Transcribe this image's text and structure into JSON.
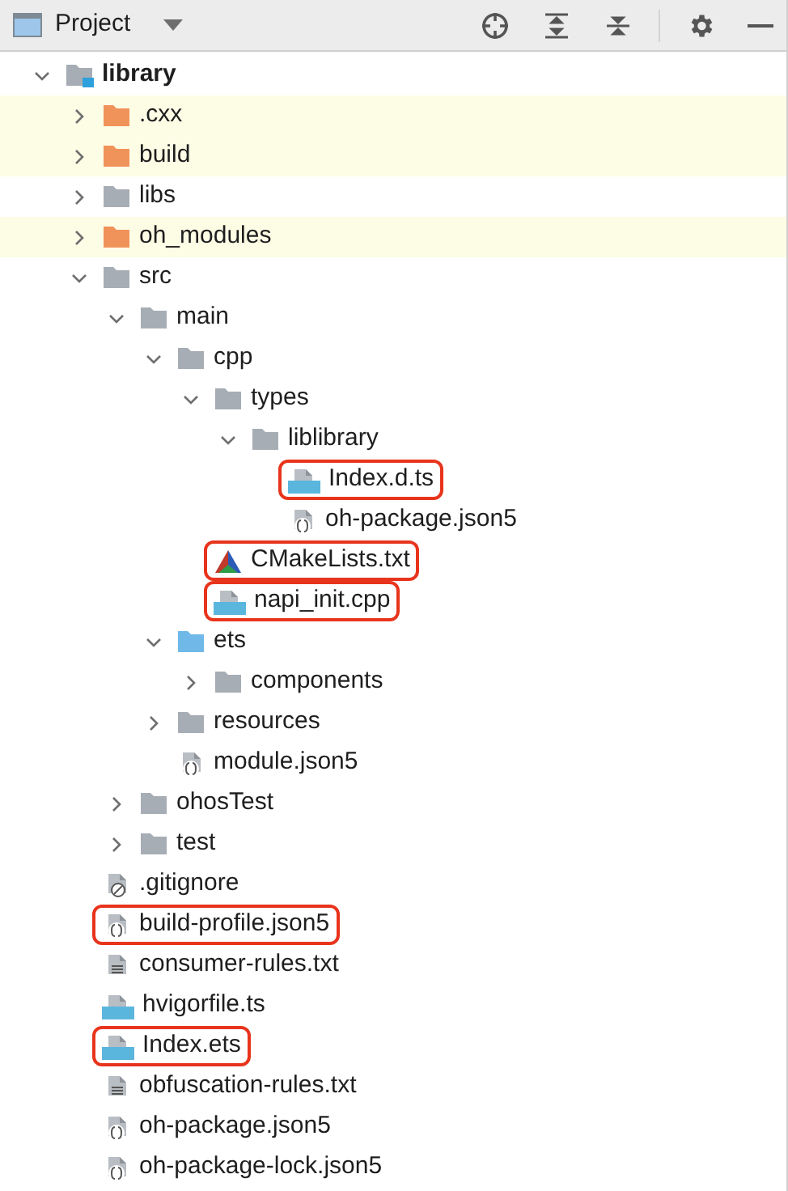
{
  "toolbar": {
    "title": "Project"
  },
  "tree": [
    {
      "name": "library",
      "kind": "module",
      "expanded": true,
      "highlighted": false,
      "children": [
        {
          "name": ".cxx",
          "kind": "excluded_folder",
          "expanded": false,
          "highlighted": false
        },
        {
          "name": "build",
          "kind": "excluded_folder",
          "expanded": false,
          "highlighted": false
        },
        {
          "name": "libs",
          "kind": "folder",
          "expanded": false,
          "highlighted": false
        },
        {
          "name": "oh_modules",
          "kind": "excluded_folder",
          "expanded": false,
          "highlighted": false
        },
        {
          "name": "src",
          "kind": "folder",
          "expanded": true,
          "highlighted": false,
          "children": [
            {
              "name": "main",
              "kind": "folder",
              "expanded": true,
              "highlighted": false,
              "children": [
                {
                  "name": "cpp",
                  "kind": "folder",
                  "expanded": true,
                  "highlighted": false,
                  "children": [
                    {
                      "name": "types",
                      "kind": "folder",
                      "expanded": true,
                      "highlighted": false,
                      "children": [
                        {
                          "name": "liblibrary",
                          "kind": "folder",
                          "expanded": true,
                          "highlighted": false,
                          "children": [
                            {
                              "name": "Index.d.ts",
                              "kind": "ts",
                              "highlighted": true
                            },
                            {
                              "name": "oh-package.json5",
                              "kind": "json",
                              "highlighted": false
                            }
                          ]
                        }
                      ]
                    },
                    {
                      "name": "CMakeLists.txt",
                      "kind": "cmake",
                      "highlighted": true
                    },
                    {
                      "name": "napi_init.cpp",
                      "kind": "cpp",
                      "highlighted": true
                    }
                  ]
                },
                {
                  "name": "ets",
                  "kind": "source_folder",
                  "expanded": true,
                  "highlighted": false,
                  "children": [
                    {
                      "name": "components",
                      "kind": "folder",
                      "expanded": false,
                      "highlighted": false
                    }
                  ]
                },
                {
                  "name": "resources",
                  "kind": "folder",
                  "expanded": false,
                  "highlighted": false
                },
                {
                  "name": "module.json5",
                  "kind": "json",
                  "highlighted": false
                }
              ]
            },
            {
              "name": "ohosTest",
              "kind": "folder",
              "expanded": false,
              "highlighted": false
            },
            {
              "name": "test",
              "kind": "folder",
              "expanded": false,
              "highlighted": false
            }
          ]
        },
        {
          "name": ".gitignore",
          "kind": "ignore",
          "highlighted": false
        },
        {
          "name": "build-profile.json5",
          "kind": "json",
          "highlighted": true
        },
        {
          "name": "consumer-rules.txt",
          "kind": "text",
          "highlighted": false
        },
        {
          "name": "hvigorfile.ts",
          "kind": "ts",
          "highlighted": false
        },
        {
          "name": "Index.ets",
          "kind": "ets",
          "highlighted": true
        },
        {
          "name": "obfuscation-rules.txt",
          "kind": "text",
          "highlighted": false
        },
        {
          "name": "oh-package.json5",
          "kind": "json",
          "highlighted": false
        },
        {
          "name": "oh-package-lock.json5",
          "kind": "json",
          "highlighted": false
        }
      ]
    }
  ]
}
